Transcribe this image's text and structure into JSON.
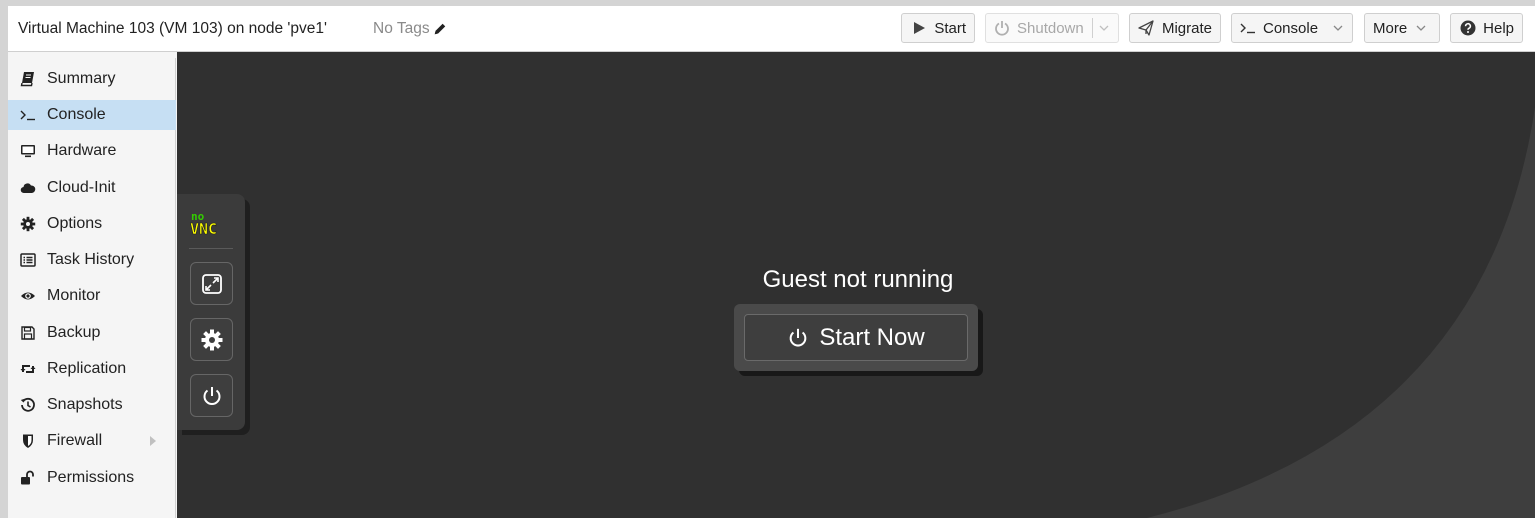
{
  "header": {
    "vm_title": "Virtual Machine 103 (VM 103) on node 'pve1'",
    "tags_label": "No Tags",
    "buttons": {
      "start": "Start",
      "shutdown": "Shutdown",
      "migrate": "Migrate",
      "console": "Console",
      "more": "More",
      "help": "Help"
    }
  },
  "sidebar": {
    "items": [
      {
        "label": "Summary",
        "icon": "book-icon"
      },
      {
        "label": "Console",
        "icon": "terminal-icon",
        "active": true
      },
      {
        "label": "Hardware",
        "icon": "monitor-icon"
      },
      {
        "label": "Cloud-Init",
        "icon": "cloud-icon"
      },
      {
        "label": "Options",
        "icon": "gear-icon"
      },
      {
        "label": "Task History",
        "icon": "list-icon"
      },
      {
        "label": "Monitor",
        "icon": "eye-icon"
      },
      {
        "label": "Backup",
        "icon": "floppy-icon"
      },
      {
        "label": "Replication",
        "icon": "retweet-icon"
      },
      {
        "label": "Snapshots",
        "icon": "history-icon"
      },
      {
        "label": "Firewall",
        "icon": "shield-icon"
      },
      {
        "label": "Permissions",
        "icon": "unlock-icon"
      }
    ]
  },
  "console": {
    "status_message": "Guest not running",
    "start_button_label": "Start Now",
    "novnc_logo": "noVNC"
  },
  "colors": {
    "console_bg": "#3e3e3e",
    "console_curve": "#303030",
    "sidebar_active": "#c6dff3",
    "novnc_green": "#33cc00",
    "novnc_yellow": "#ffff00"
  }
}
